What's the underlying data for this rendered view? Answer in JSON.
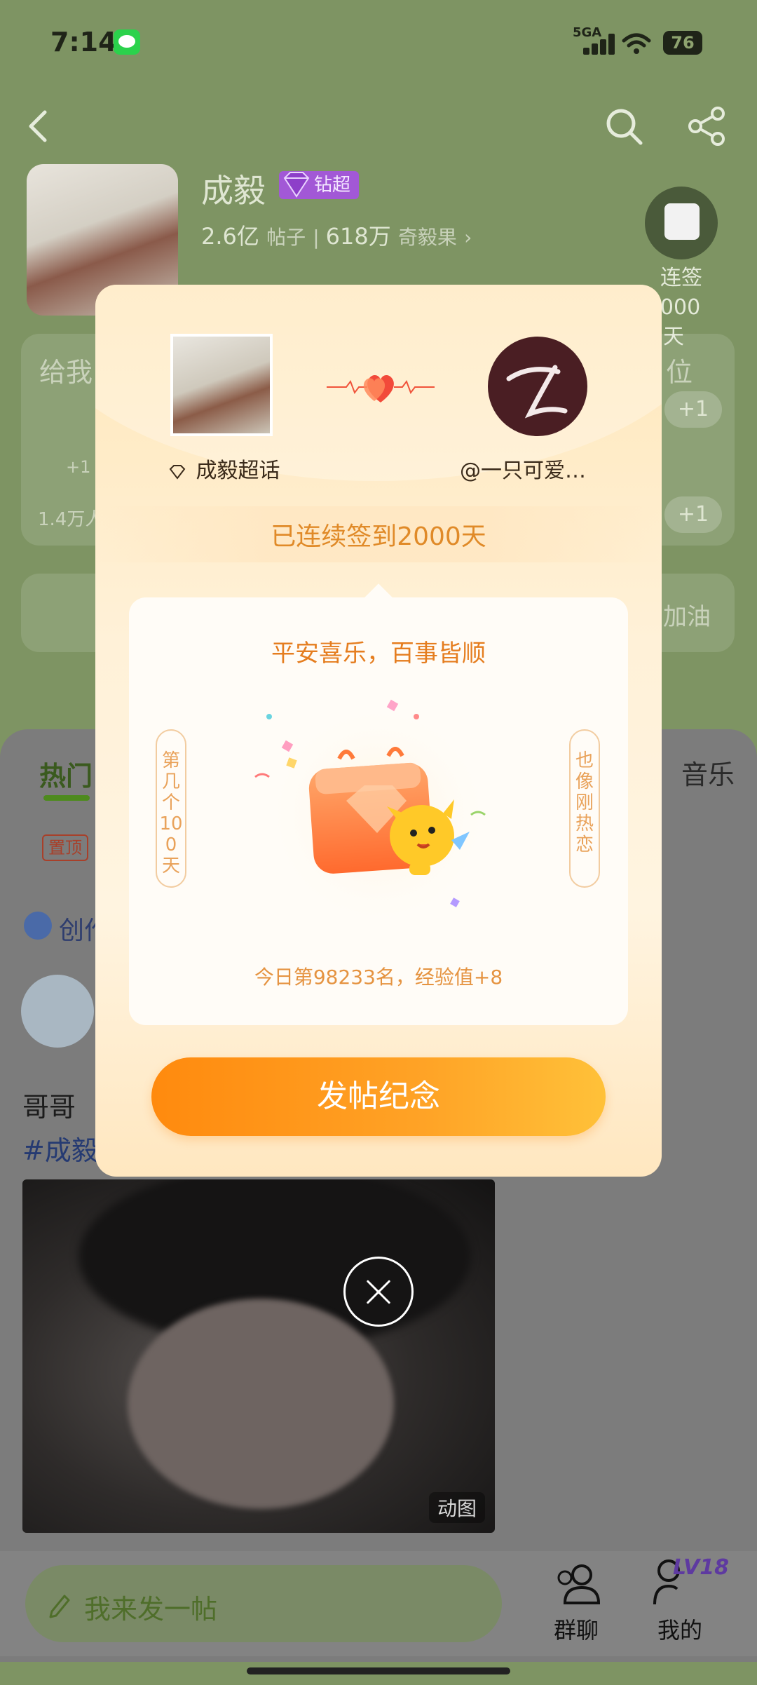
{
  "status_bar": {
    "time": "7:14",
    "network": "5GA",
    "battery": "76"
  },
  "topic": {
    "name": "成毅",
    "badge": "钻超",
    "posts_count": "2.6亿",
    "posts_label": "帖子",
    "fans_count": "618万",
    "fans_label": "奇毅果",
    "checkin_label": "连签",
    "checkin_days": "2000天"
  },
  "background": {
    "card1_title": "给我",
    "card1_right": "位",
    "plus_one": "+1",
    "plus_two": "+1",
    "small_plus": "+1",
    "count_text": "1.4万人",
    "write_right": "加油",
    "feed_tab_active": "热门",
    "feed_tab_right": "音乐",
    "pin_tag": "置顶",
    "create_label": "创作",
    "post_text": "哥哥",
    "post_hashtag": "#成毅",
    "gif_label": "动图"
  },
  "bottom_bar": {
    "compose_placeholder": "我来发一帖",
    "group_chat": "群聊",
    "mine": "我的",
    "level": "LV18"
  },
  "modal": {
    "left_name": "成毅超话",
    "right_name": "@一只可爱…",
    "streak_text": "已连续签到2000天",
    "blessing": "平安喜乐，百事皆顺",
    "side_left": "第几个100天",
    "side_right": "也像刚热恋",
    "rank_text": "今日第98233名，经验值+8",
    "button": "发帖纪念"
  },
  "colors": {
    "accent_orange": "#ff8a0e",
    "streak_text": "#e08a28",
    "header_green": "#7e9463",
    "vip_purple": "#a258d6"
  }
}
